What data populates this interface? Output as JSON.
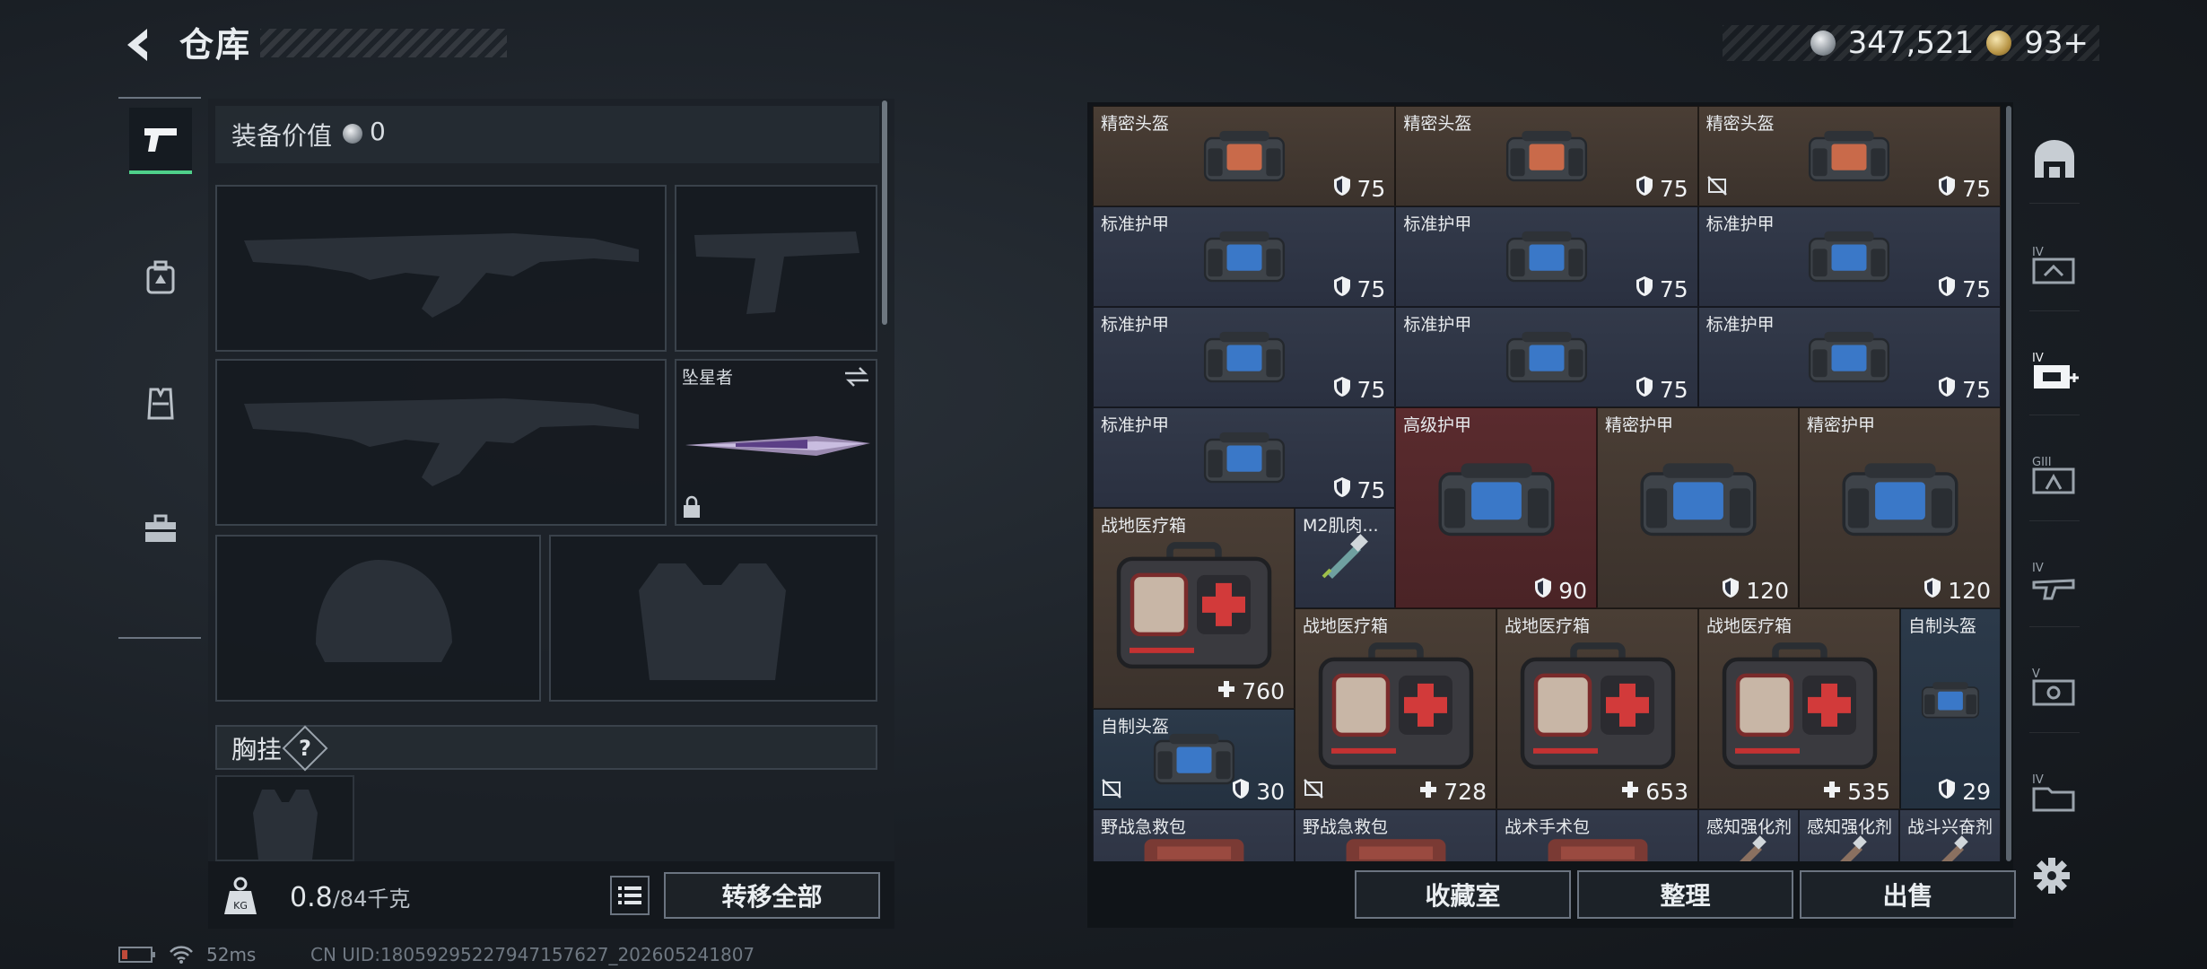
{
  "header": {
    "title": "仓库"
  },
  "currency": {
    "silver": "347,521",
    "gold": "93+"
  },
  "equipment": {
    "value_label": "装备价值",
    "value": "0"
  },
  "melee": {
    "name": "坠星者"
  },
  "chest_rig": {
    "label": "胸挂",
    "help": "?"
  },
  "capacity": {
    "current": "0.8",
    "max": "/84千克"
  },
  "buttons": {
    "transfer_all": "转移全部",
    "collection": "收藏室",
    "organize": "整理",
    "sell": "出售"
  },
  "items": [
    {
      "name": "精密头盔",
      "value": "75",
      "stat": "armor",
      "color": "brown"
    },
    {
      "name": "精密头盔",
      "value": "75",
      "stat": "armor",
      "color": "brown"
    },
    {
      "name": "精密头盔",
      "value": "75",
      "stat": "armor",
      "color": "brown",
      "flag": "no-insure"
    },
    {
      "name": "标准护甲",
      "value": "75",
      "stat": "armor",
      "color": "blue"
    },
    {
      "name": "标准护甲",
      "value": "75",
      "stat": "armor",
      "color": "blue"
    },
    {
      "name": "标准护甲",
      "value": "75",
      "stat": "armor",
      "color": "blue"
    },
    {
      "name": "标准护甲",
      "value": "75",
      "stat": "armor",
      "color": "blue"
    },
    {
      "name": "标准护甲",
      "value": "75",
      "stat": "armor",
      "color": "blue"
    },
    {
      "name": "标准护甲",
      "value": "75",
      "stat": "armor",
      "color": "blue"
    },
    {
      "name": "标准护甲",
      "value": "75",
      "stat": "armor",
      "color": "blue"
    },
    {
      "name": "高级护甲",
      "value": "90",
      "stat": "armor",
      "color": "red"
    },
    {
      "name": "精密护甲",
      "value": "120",
      "stat": "armor",
      "color": "brown"
    },
    {
      "name": "精密护甲",
      "value": "120",
      "stat": "armor",
      "color": "brown"
    },
    {
      "name": "战地医疗箱",
      "value": "760",
      "stat": "heal",
      "color": "brown"
    },
    {
      "name": "M2肌肉...",
      "value": "",
      "stat": "none",
      "color": "blue"
    },
    {
      "name": "战地医疗箱",
      "value": "728",
      "stat": "heal",
      "color": "brown",
      "flag": "no-insure"
    },
    {
      "name": "战地医疗箱",
      "value": "653",
      "stat": "heal",
      "color": "brown"
    },
    {
      "name": "战地医疗箱",
      "value": "535",
      "stat": "heal",
      "color": "brown"
    },
    {
      "name": "自制头盔",
      "value": "29",
      "stat": "armor",
      "color": "steel"
    },
    {
      "name": "自制头盔",
      "value": "30",
      "stat": "armor",
      "color": "steel",
      "flag": "no-insure"
    },
    {
      "name": "野战急救包",
      "value": "",
      "stat": "none",
      "color": "blue"
    },
    {
      "name": "野战急救包",
      "value": "",
      "stat": "none",
      "color": "blue"
    },
    {
      "name": "战术手术包",
      "value": "",
      "stat": "none",
      "color": "blue"
    },
    {
      "name": "感知强化剂",
      "value": "",
      "stat": "none",
      "color": "blue"
    },
    {
      "name": "感知强化剂",
      "value": "",
      "stat": "none",
      "color": "blue"
    },
    {
      "name": "战斗兴奋剂",
      "value": "",
      "stat": "none",
      "color": "blue"
    }
  ],
  "status": {
    "ping": "52ms",
    "uid": "CN UID:18059295227947157627_202605241807"
  },
  "colors": {
    "accent_green": "#4fd08a",
    "brown_cell": "#4a3e35",
    "blue_cell": "#333a4a",
    "red_cell": "#5a2b2e"
  }
}
